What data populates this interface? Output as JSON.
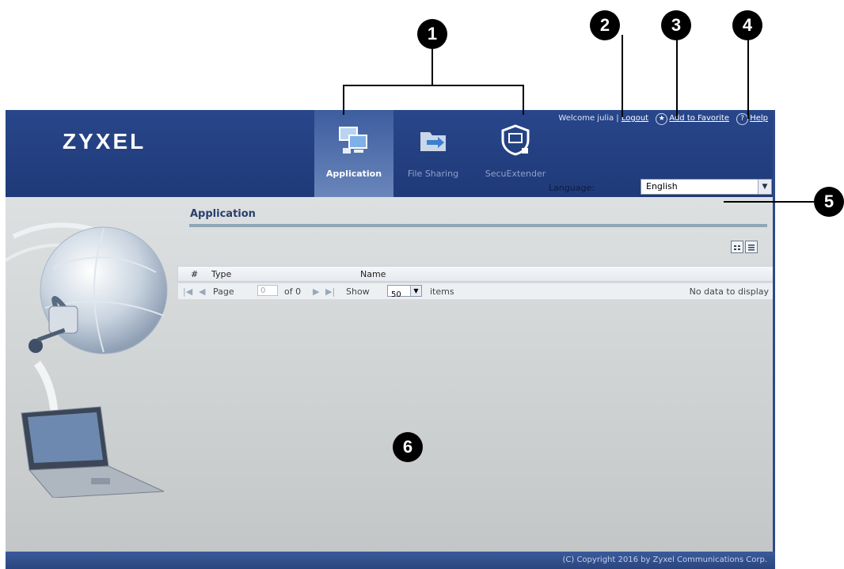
{
  "callouts": [
    "1",
    "2",
    "3",
    "4",
    "5",
    "6"
  ],
  "header": {
    "logo": "ZYXEL",
    "welcome": "Welcome julia | ",
    "logout": "Logout",
    "favorite": "Add to Favorite",
    "help": "Help",
    "help_icon_text": "?",
    "language_label": "Language:",
    "language_value": "English",
    "tabs": [
      {
        "label": "Application",
        "icon": "application-icon",
        "active": true
      },
      {
        "label": "File Sharing",
        "icon": "file-sharing-icon",
        "active": false
      },
      {
        "label": "SecuExtender",
        "icon": "secuextender-icon",
        "active": false
      }
    ]
  },
  "main": {
    "section_title": "Application",
    "columns": [
      "#",
      "Type",
      "Name"
    ],
    "pager": {
      "page_label": "Page",
      "page_value": "0",
      "of_label": "of 0",
      "show_label": "Show",
      "show_value": "50",
      "items_label": "items",
      "status": "No data to display"
    }
  },
  "footer": {
    "copyright": "(C) Copyright 2016 by Zyxel Communications Corp."
  },
  "colors": {
    "header_bg": "#28468a",
    "main_bg": "#dde0e1",
    "accent_rule": "#8ea7b8",
    "title_text": "#2a3e6c"
  }
}
